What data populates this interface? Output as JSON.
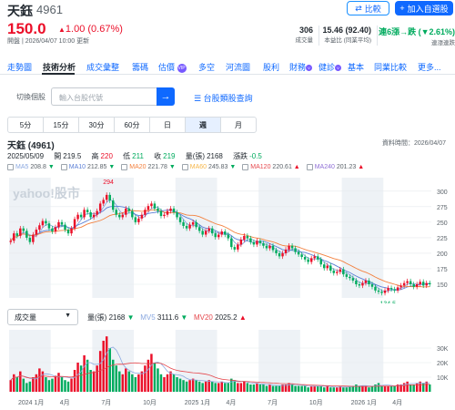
{
  "header": {
    "name": "天鈺",
    "code": "4961",
    "compare_label": "比較",
    "add_label": "加入自選股",
    "price": "150.0",
    "change": "1.00 (0.67%)",
    "timestamp": "開盤 | 2026/04/07 10:00 更新",
    "stats": [
      {
        "value": "306",
        "label": "成交量"
      },
      {
        "value": "15.46 (92.40)",
        "label": "本益比 (同業平均)"
      },
      {
        "value": "連6漲→跌 (▼2.61%)",
        "label": "連漲連跌"
      }
    ]
  },
  "tabs": [
    "走勢圖",
    "技術分析",
    "成交彙整",
    "籌碼",
    "估價",
    "多空",
    "河流圖",
    "股利",
    "財務",
    "健診",
    "基本",
    "同業比較",
    "更多..."
  ],
  "active_tab": "技術分析",
  "search": {
    "switch_label": "切換個股",
    "placeholder": "輸入台股代號",
    "category_link": "台股類股查詢"
  },
  "periods": [
    "5分",
    "15分",
    "30分",
    "60分",
    "日",
    "週",
    "月"
  ],
  "active_period": "週",
  "chart_header": {
    "title": "天鈺 (4961)",
    "data_time": "資料時間：2026/04/07",
    "date": "2025/05/09",
    "open_label": "開",
    "open": "219.5",
    "high_label": "高",
    "high": "220",
    "low_label": "低",
    "low": "211",
    "close_label": "收",
    "close": "219",
    "vol_label": "量(張)",
    "vol": "2168",
    "chg_label": "漲跌",
    "chg": "-0.5"
  },
  "ma": [
    {
      "name": "MA5",
      "value": "208.8",
      "dir": "▼",
      "color": "#8aa8e0"
    },
    {
      "name": "MA10",
      "value": "212.85",
      "dir": "▼",
      "color": "#5b7fd6"
    },
    {
      "name": "MA20",
      "value": "221.78",
      "dir": "▼",
      "color": "#f3813f"
    },
    {
      "name": "MA60",
      "value": "245.83",
      "dir": "▼",
      "color": "#f6b74a"
    },
    {
      "name": "MA120",
      "value": "220.61",
      "dir": "▲",
      "color": "#e5484d"
    },
    {
      "name": "MA240",
      "value": "201.23",
      "dir": "▲",
      "color": "#8f6fd6"
    }
  ],
  "volume": {
    "select_label": "成交量",
    "vol_label": "量(張)",
    "vol_value": "2168",
    "vol_dir": "▼",
    "mv5_label": "MV5",
    "mv5_value": "3111.6",
    "mv5_dir": "▼",
    "mv20_label": "MV20",
    "mv20_value": "2025.2",
    "mv20_dir": "▲"
  },
  "chart_data": {
    "type": "candlestick",
    "watermark": "yahoo!股市",
    "price_ticks": [
      "300",
      "275",
      "250",
      "225",
      "200",
      "175",
      "150"
    ],
    "price_range": [
      128,
      310
    ],
    "volume_ticks": [
      "30K",
      "20K",
      "10K"
    ],
    "volume_range": [
      0,
      40
    ],
    "x_labels": [
      "2024 1月",
      "4月",
      "7月",
      "10月",
      "2025 1月",
      "4月",
      "7月",
      "10月",
      "2026 1月",
      "4月"
    ],
    "annotations": [
      {
        "label": "294"
      },
      {
        "label": "134.5"
      }
    ],
    "colors": {
      "up": "#eb0f29",
      "down": "#00ab5e"
    },
    "closes": [
      220,
      232,
      228,
      240,
      236,
      225,
      218,
      230,
      238,
      245,
      252,
      248,
      240,
      235,
      242,
      250,
      246,
      238,
      232,
      240,
      255,
      262,
      258,
      270,
      266,
      258,
      262,
      268,
      280,
      286,
      294,
      285,
      270,
      262,
      258,
      262,
      272,
      268,
      258,
      250,
      256,
      262,
      270,
      276,
      280,
      272,
      268,
      260,
      262,
      268,
      272,
      266,
      258,
      250,
      244,
      240,
      246,
      250,
      242,
      236,
      230,
      236,
      240,
      232,
      226,
      230,
      235,
      230,
      224,
      210,
      206,
      214,
      222,
      228,
      224,
      218,
      214,
      220,
      216,
      212,
      208,
      212,
      205,
      200,
      195,
      200,
      206,
      212,
      208,
      202,
      198,
      194,
      190,
      186,
      192,
      195,
      190,
      182,
      176,
      180,
      172,
      168,
      170,
      174,
      166,
      162,
      160,
      156,
      150,
      148,
      152,
      156,
      150,
      146,
      140,
      138,
      136,
      140,
      144,
      142,
      140,
      145,
      148,
      152,
      155,
      150,
      146,
      150,
      154,
      148,
      152,
      150
    ],
    "volumes": [
      8,
      12,
      10,
      14,
      9,
      6,
      7,
      10,
      12,
      16,
      14,
      10,
      8,
      9,
      11,
      13,
      10,
      8,
      7,
      9,
      15,
      20,
      18,
      25,
      22,
      15,
      14,
      18,
      28,
      35,
      38,
      30,
      22,
      18,
      14,
      12,
      16,
      14,
      12,
      10,
      12,
      14,
      18,
      22,
      26,
      20,
      16,
      12,
      10,
      12,
      14,
      12,
      10,
      9,
      8,
      7,
      8,
      9,
      8,
      7,
      6,
      7,
      8,
      7,
      6,
      6,
      7,
      6,
      6,
      9,
      8,
      6,
      6,
      7,
      6,
      5,
      5,
      6,
      5,
      5,
      4,
      5,
      4,
      4,
      4,
      5,
      5,
      6,
      5,
      4,
      4,
      4,
      4,
      3,
      4,
      4,
      4,
      4,
      3,
      4,
      3,
      3,
      3,
      4,
      3,
      3,
      4,
      4,
      5,
      4,
      4,
      4,
      3,
      4,
      5,
      6,
      4,
      4,
      4,
      4,
      4,
      5,
      5,
      6,
      7,
      5,
      5,
      6,
      7,
      6,
      7,
      5
    ]
  }
}
